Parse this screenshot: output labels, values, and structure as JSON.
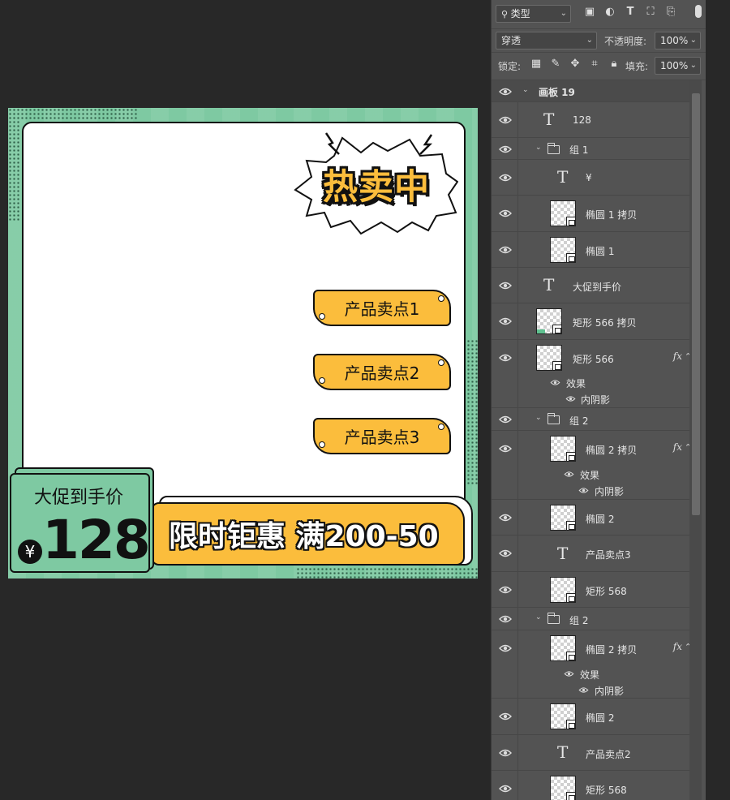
{
  "canvas": {
    "hot_badge": "热卖中",
    "selling_points": [
      "产品卖点1",
      "产品卖点2",
      "产品卖点3"
    ],
    "price_label": "大促到手价",
    "currency": "¥",
    "price": "128",
    "promo_banner": "限时钜惠 满200-50",
    "colors": {
      "mint": "#7ec9a2",
      "yellow": "#fbbd3c",
      "outline": "#111111",
      "workspace": "#282828"
    }
  },
  "panel": {
    "filter_kind": "类型",
    "blend_mode": "穿透",
    "opacity_label": "不透明度:",
    "opacity_value": "100%",
    "lock_label": "锁定:",
    "fill_label": "填充:",
    "fill_value": "100%",
    "colors": {
      "panel_bg": "#535353",
      "field_bg": "#454545"
    }
  },
  "layers": [
    {
      "name": "画板 19",
      "type": "artboard"
    },
    {
      "name": "128",
      "type": "text"
    },
    {
      "name": "组 1",
      "type": "group"
    },
    {
      "name": "¥",
      "type": "text"
    },
    {
      "name": "椭圆 1 拷贝",
      "type": "shape"
    },
    {
      "name": "椭圆 1",
      "type": "shape"
    },
    {
      "name": "大促到手价",
      "type": "text"
    },
    {
      "name": "矩形 566 拷贝",
      "type": "shape"
    },
    {
      "name": "矩形 566",
      "type": "shape",
      "fx": "fx",
      "effects_label": "效果",
      "effect": "内阴影"
    },
    {
      "name": "组 2",
      "type": "group"
    },
    {
      "name": "椭圆 2 拷贝",
      "type": "shape",
      "fx": "fx",
      "effects_label": "效果",
      "effect": "内阴影"
    },
    {
      "name": "椭圆 2",
      "type": "shape"
    },
    {
      "name": "产品卖点3",
      "type": "text"
    },
    {
      "name": "矩形 568",
      "type": "shape"
    },
    {
      "name": "组 2",
      "type": "group"
    },
    {
      "name": "椭圆 2 拷贝",
      "type": "shape",
      "fx": "fx",
      "effects_label": "效果",
      "effect": "内阴影"
    },
    {
      "name": "椭圆 2",
      "type": "shape"
    },
    {
      "name": "产品卖点2",
      "type": "text"
    },
    {
      "name": "矩形 568",
      "type": "shape"
    }
  ],
  "icons": [
    "search-icon",
    "image-filter-icon",
    "adjustment-filter-icon",
    "type-filter-icon",
    "shape-filter-icon",
    "smart-object-filter-icon",
    "eye-icon",
    "folder-icon",
    "text-layer-icon",
    "fx-icon"
  ]
}
